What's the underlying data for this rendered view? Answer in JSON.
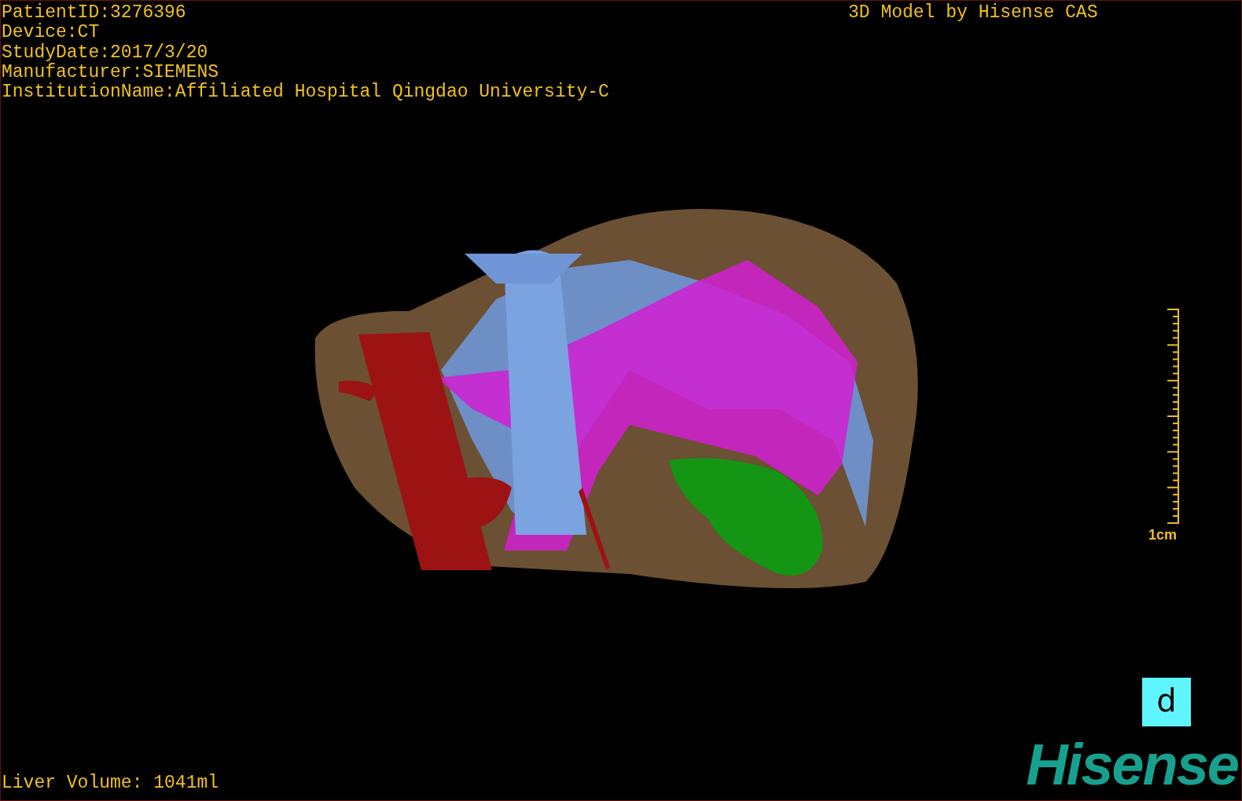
{
  "info_lines": [
    "PatientID:3276396",
    "Device:CT",
    "StudyDate:2017/3/20",
    "Manufacturer:SIEMENS",
    "InstitutionName:Affiliated Hospital Qingdao University-C"
  ],
  "watermark_title": "3D Model by Hisense CAS",
  "scale": {
    "label": "1cm"
  },
  "orientation_marker": "d",
  "logo": "Hisense",
  "liver_volume": "Liver Volume: 1041ml"
}
